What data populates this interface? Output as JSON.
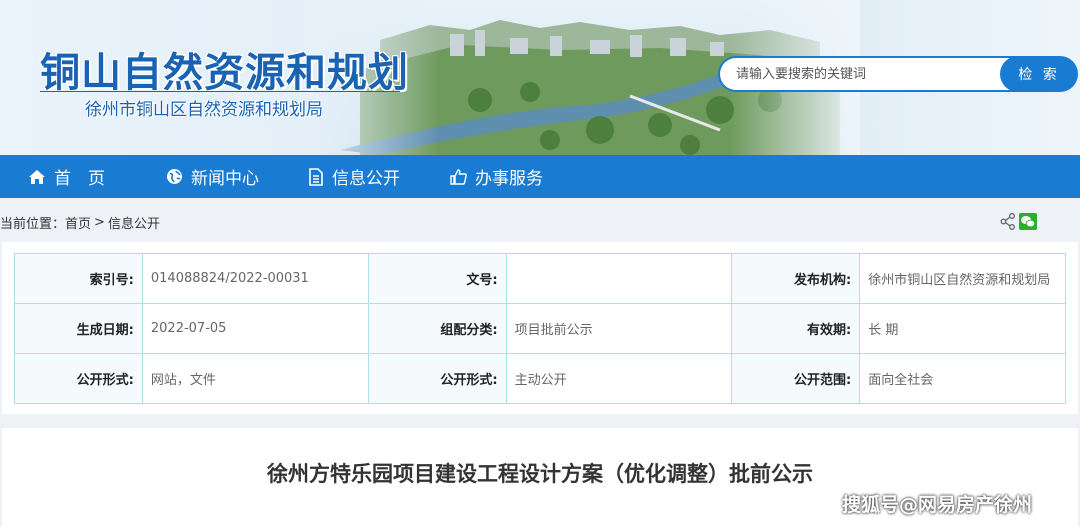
{
  "header": {
    "title": "铜山自然资源和规划",
    "subtitle": "徐州市铜山区自然资源和规划局",
    "search": {
      "placeholder": "请输入要搜索的关键词",
      "button": "检 索"
    }
  },
  "nav": [
    {
      "label": "首　页",
      "icon": "home-icon"
    },
    {
      "label": "新闻中心",
      "icon": "globe-icon"
    },
    {
      "label": "信息公开",
      "icon": "document-icon"
    },
    {
      "label": "办事服务",
      "icon": "thumbs-up-icon"
    }
  ],
  "breadcrumb": {
    "prefix": "当前位置：",
    "items": [
      "首页",
      "信息公开"
    ],
    "separator": ">"
  },
  "share_icons": [
    "share-icon",
    "wechat-icon"
  ],
  "meta": {
    "rows": [
      [
        {
          "label": "索引号:",
          "value": "014088824/2022-00031"
        },
        {
          "label": "文号:",
          "value": ""
        },
        {
          "label": "发布机构:",
          "value": "徐州市铜山区自然资源和规划局"
        }
      ],
      [
        {
          "label": "生成日期:",
          "value": "2022-07-05"
        },
        {
          "label": "组配分类:",
          "value": "项目批前公示"
        },
        {
          "label": "有效期:",
          "value": "长 期"
        }
      ],
      [
        {
          "label": "公开形式:",
          "value": "网站，文件"
        },
        {
          "label": "公开形式:",
          "value": "主动公开"
        },
        {
          "label": "公开范围:",
          "value": "面向全社会"
        }
      ]
    ]
  },
  "article": {
    "title": "徐州方特乐园项目建设工程设计方案（优化调整）批前公示"
  },
  "watermark": "搜狐号@网易房产徐州",
  "colors": {
    "brand": "#1a7bd3",
    "title": "#1a63b4",
    "table_border": "#aee0ea"
  }
}
